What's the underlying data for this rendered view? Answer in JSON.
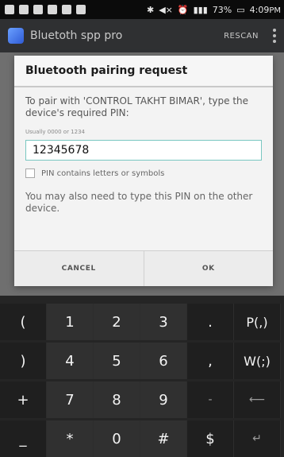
{
  "status_bar": {
    "battery": "73%",
    "time": "4:09",
    "time_suffix": "PM"
  },
  "app_bar": {
    "title": "Bluetoth spp pro",
    "rescan": "RESCAN"
  },
  "dialog": {
    "title": "Bluetooth pairing request",
    "message": "To pair with 'CONTROL TAKHT BIMAR', type the device's required PIN:",
    "hint": "Usually 0000 or 1234",
    "pin_value": "12345678",
    "checkbox_label": "PIN contains letters or symbols",
    "note": "You may also need to type this PIN on the other device.",
    "cancel": "CANCEL",
    "ok": "OK"
  },
  "keyboard": {
    "row1": [
      "(",
      "1",
      "2",
      "3",
      ".",
      "P(,)"
    ],
    "row2": [
      ")",
      "4",
      "5",
      "6",
      ",",
      "W(;)"
    ],
    "row3": [
      "+",
      "7",
      "8",
      "9",
      "-",
      "⟵"
    ],
    "row4": [
      "_",
      "*",
      "0",
      "#",
      "$",
      "↵"
    ]
  }
}
